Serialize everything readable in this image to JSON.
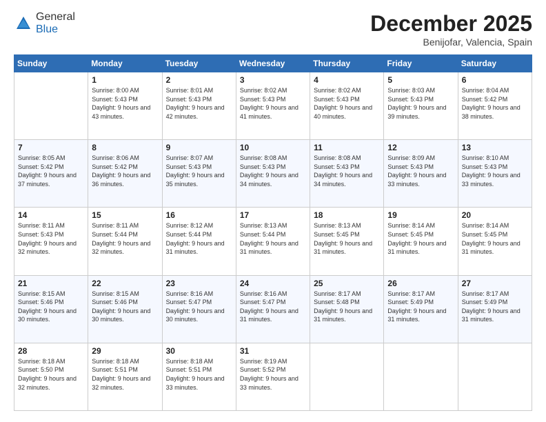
{
  "logo": {
    "general": "General",
    "blue": "Blue"
  },
  "header": {
    "month": "December 2025",
    "location": "Benijofar, Valencia, Spain"
  },
  "weekdays": [
    "Sunday",
    "Monday",
    "Tuesday",
    "Wednesday",
    "Thursday",
    "Friday",
    "Saturday"
  ],
  "weeks": [
    [
      {
        "day": "",
        "sunrise": "",
        "sunset": "",
        "daylight": ""
      },
      {
        "day": "1",
        "sunrise": "Sunrise: 8:00 AM",
        "sunset": "Sunset: 5:43 PM",
        "daylight": "Daylight: 9 hours and 43 minutes."
      },
      {
        "day": "2",
        "sunrise": "Sunrise: 8:01 AM",
        "sunset": "Sunset: 5:43 PM",
        "daylight": "Daylight: 9 hours and 42 minutes."
      },
      {
        "day": "3",
        "sunrise": "Sunrise: 8:02 AM",
        "sunset": "Sunset: 5:43 PM",
        "daylight": "Daylight: 9 hours and 41 minutes."
      },
      {
        "day": "4",
        "sunrise": "Sunrise: 8:02 AM",
        "sunset": "Sunset: 5:43 PM",
        "daylight": "Daylight: 9 hours and 40 minutes."
      },
      {
        "day": "5",
        "sunrise": "Sunrise: 8:03 AM",
        "sunset": "Sunset: 5:43 PM",
        "daylight": "Daylight: 9 hours and 39 minutes."
      },
      {
        "day": "6",
        "sunrise": "Sunrise: 8:04 AM",
        "sunset": "Sunset: 5:42 PM",
        "daylight": "Daylight: 9 hours and 38 minutes."
      }
    ],
    [
      {
        "day": "7",
        "sunrise": "Sunrise: 8:05 AM",
        "sunset": "Sunset: 5:42 PM",
        "daylight": "Daylight: 9 hours and 37 minutes."
      },
      {
        "day": "8",
        "sunrise": "Sunrise: 8:06 AM",
        "sunset": "Sunset: 5:42 PM",
        "daylight": "Daylight: 9 hours and 36 minutes."
      },
      {
        "day": "9",
        "sunrise": "Sunrise: 8:07 AM",
        "sunset": "Sunset: 5:43 PM",
        "daylight": "Daylight: 9 hours and 35 minutes."
      },
      {
        "day": "10",
        "sunrise": "Sunrise: 8:08 AM",
        "sunset": "Sunset: 5:43 PM",
        "daylight": "Daylight: 9 hours and 34 minutes."
      },
      {
        "day": "11",
        "sunrise": "Sunrise: 8:08 AM",
        "sunset": "Sunset: 5:43 PM",
        "daylight": "Daylight: 9 hours and 34 minutes."
      },
      {
        "day": "12",
        "sunrise": "Sunrise: 8:09 AM",
        "sunset": "Sunset: 5:43 PM",
        "daylight": "Daylight: 9 hours and 33 minutes."
      },
      {
        "day": "13",
        "sunrise": "Sunrise: 8:10 AM",
        "sunset": "Sunset: 5:43 PM",
        "daylight": "Daylight: 9 hours and 33 minutes."
      }
    ],
    [
      {
        "day": "14",
        "sunrise": "Sunrise: 8:11 AM",
        "sunset": "Sunset: 5:43 PM",
        "daylight": "Daylight: 9 hours and 32 minutes."
      },
      {
        "day": "15",
        "sunrise": "Sunrise: 8:11 AM",
        "sunset": "Sunset: 5:44 PM",
        "daylight": "Daylight: 9 hours and 32 minutes."
      },
      {
        "day": "16",
        "sunrise": "Sunrise: 8:12 AM",
        "sunset": "Sunset: 5:44 PM",
        "daylight": "Daylight: 9 hours and 31 minutes."
      },
      {
        "day": "17",
        "sunrise": "Sunrise: 8:13 AM",
        "sunset": "Sunset: 5:44 PM",
        "daylight": "Daylight: 9 hours and 31 minutes."
      },
      {
        "day": "18",
        "sunrise": "Sunrise: 8:13 AM",
        "sunset": "Sunset: 5:45 PM",
        "daylight": "Daylight: 9 hours and 31 minutes."
      },
      {
        "day": "19",
        "sunrise": "Sunrise: 8:14 AM",
        "sunset": "Sunset: 5:45 PM",
        "daylight": "Daylight: 9 hours and 31 minutes."
      },
      {
        "day": "20",
        "sunrise": "Sunrise: 8:14 AM",
        "sunset": "Sunset: 5:45 PM",
        "daylight": "Daylight: 9 hours and 31 minutes."
      }
    ],
    [
      {
        "day": "21",
        "sunrise": "Sunrise: 8:15 AM",
        "sunset": "Sunset: 5:46 PM",
        "daylight": "Daylight: 9 hours and 30 minutes."
      },
      {
        "day": "22",
        "sunrise": "Sunrise: 8:15 AM",
        "sunset": "Sunset: 5:46 PM",
        "daylight": "Daylight: 9 hours and 30 minutes."
      },
      {
        "day": "23",
        "sunrise": "Sunrise: 8:16 AM",
        "sunset": "Sunset: 5:47 PM",
        "daylight": "Daylight: 9 hours and 30 minutes."
      },
      {
        "day": "24",
        "sunrise": "Sunrise: 8:16 AM",
        "sunset": "Sunset: 5:47 PM",
        "daylight": "Daylight: 9 hours and 31 minutes."
      },
      {
        "day": "25",
        "sunrise": "Sunrise: 8:17 AM",
        "sunset": "Sunset: 5:48 PM",
        "daylight": "Daylight: 9 hours and 31 minutes."
      },
      {
        "day": "26",
        "sunrise": "Sunrise: 8:17 AM",
        "sunset": "Sunset: 5:49 PM",
        "daylight": "Daylight: 9 hours and 31 minutes."
      },
      {
        "day": "27",
        "sunrise": "Sunrise: 8:17 AM",
        "sunset": "Sunset: 5:49 PM",
        "daylight": "Daylight: 9 hours and 31 minutes."
      }
    ],
    [
      {
        "day": "28",
        "sunrise": "Sunrise: 8:18 AM",
        "sunset": "Sunset: 5:50 PM",
        "daylight": "Daylight: 9 hours and 32 minutes."
      },
      {
        "day": "29",
        "sunrise": "Sunrise: 8:18 AM",
        "sunset": "Sunset: 5:51 PM",
        "daylight": "Daylight: 9 hours and 32 minutes."
      },
      {
        "day": "30",
        "sunrise": "Sunrise: 8:18 AM",
        "sunset": "Sunset: 5:51 PM",
        "daylight": "Daylight: 9 hours and 33 minutes."
      },
      {
        "day": "31",
        "sunrise": "Sunrise: 8:19 AM",
        "sunset": "Sunset: 5:52 PM",
        "daylight": "Daylight: 9 hours and 33 minutes."
      },
      {
        "day": "",
        "sunrise": "",
        "sunset": "",
        "daylight": ""
      },
      {
        "day": "",
        "sunrise": "",
        "sunset": "",
        "daylight": ""
      },
      {
        "day": "",
        "sunrise": "",
        "sunset": "",
        "daylight": ""
      }
    ]
  ]
}
